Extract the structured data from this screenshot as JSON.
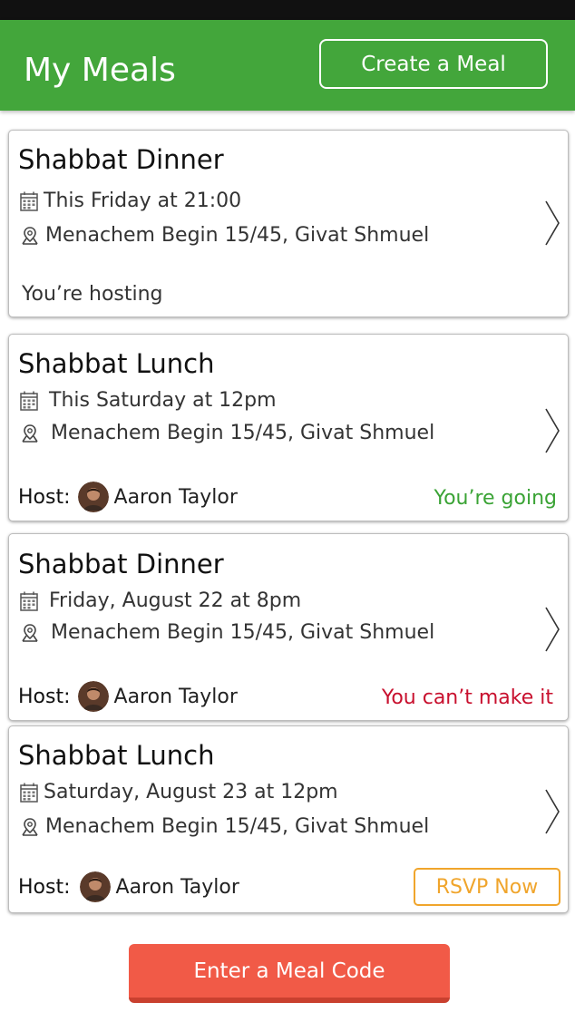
{
  "header": {
    "title": "My Meals",
    "create_label": "Create a Meal",
    "bg_color": "#43a63b"
  },
  "meals": [
    {
      "title": "Shabbat Dinner",
      "date": "This Friday at 21:00",
      "location": "Menachem Begin 15/45, Givat Shmuel",
      "status_text": "You’re hosting"
    },
    {
      "title": "Shabbat Lunch",
      "date": "This Saturday at 12pm",
      "location": "Menachem Begin 15/45, Givat Shmuel",
      "host_label": "Host:",
      "host_name": "Aaron Taylor",
      "status_text": "You’re going",
      "status_color": "#3aa335"
    },
    {
      "title": "Shabbat Dinner",
      "date": "Friday, August 22 at 8pm",
      "location": "Menachem Begin 15/45, Givat Shmuel",
      "host_label": "Host:",
      "host_name": "Aaron Taylor",
      "status_text": "You can’t make it",
      "status_color": "#c8102e"
    },
    {
      "title": "Shabbat Lunch",
      "date": "Saturday, August 23 at 12pm",
      "location": "Menachem Begin 15/45, Givat Shmuel",
      "host_label": "Host:",
      "host_name": "Aaron Taylor",
      "rsvp_label": "RSVP Now",
      "rsvp_color": "#f0a52c"
    }
  ],
  "footer": {
    "code_label": "Enter a Meal Code",
    "button_color": "#f15a47"
  }
}
